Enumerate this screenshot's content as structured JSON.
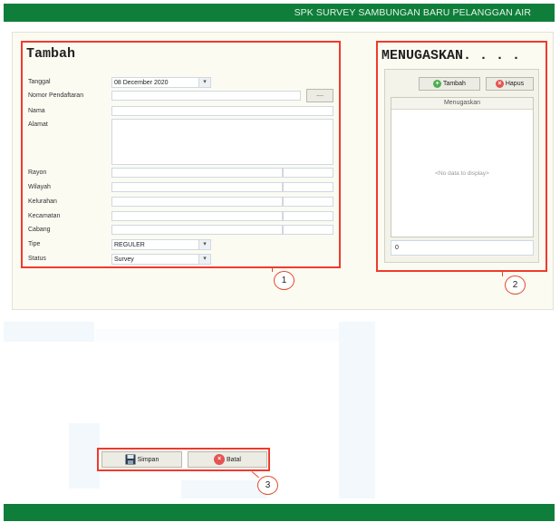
{
  "header": {
    "title": "SPK SURVEY SAMBUNGAN BARU PELANGGAN AIR"
  },
  "form": {
    "heading": "Tambah",
    "fields": {
      "tanggal": {
        "label": "Tanggal",
        "value": "08 December 2020"
      },
      "nomor": {
        "label": "Nomor Pendaftaran",
        "value": ""
      },
      "nama": {
        "label": "Nama",
        "value": ""
      },
      "alamat": {
        "label": "Alamat",
        "value": ""
      },
      "rayon": {
        "label": "Rayon",
        "value": ""
      },
      "wilayah": {
        "label": "Wilayah",
        "value": ""
      },
      "kelurahan": {
        "label": "Kelurahan",
        "value": ""
      },
      "kecamatan": {
        "label": "Kecamatan",
        "value": ""
      },
      "cabang": {
        "label": "Cabang",
        "value": ""
      },
      "tipe": {
        "label": "Tipe",
        "value": "REGULER"
      },
      "status": {
        "label": "Status",
        "value": "Survey"
      }
    },
    "lookup_button": "....",
    "callout": "1"
  },
  "assign": {
    "heading": "MENUGASKAN. . . .",
    "add_button": "Tambah",
    "delete_button": "Hapus",
    "grid_header": "Menugaskan",
    "empty_text": "<No data to display>",
    "count_value": "0",
    "callout": "2"
  },
  "actions": {
    "save_label": "Simpan",
    "cancel_label": "Batal",
    "callout": "3"
  },
  "colors": {
    "brand_green": "#0f7e3a",
    "highlight_red": "#ef3b2c",
    "add_green": "#4caf50",
    "delete_red": "#e55353"
  },
  "icons": {
    "add": "plus-circle-icon",
    "delete": "x-circle-icon",
    "save": "floppy-disk-icon",
    "cancel": "x-circle-icon",
    "dropdown": "chevron-down-icon"
  }
}
